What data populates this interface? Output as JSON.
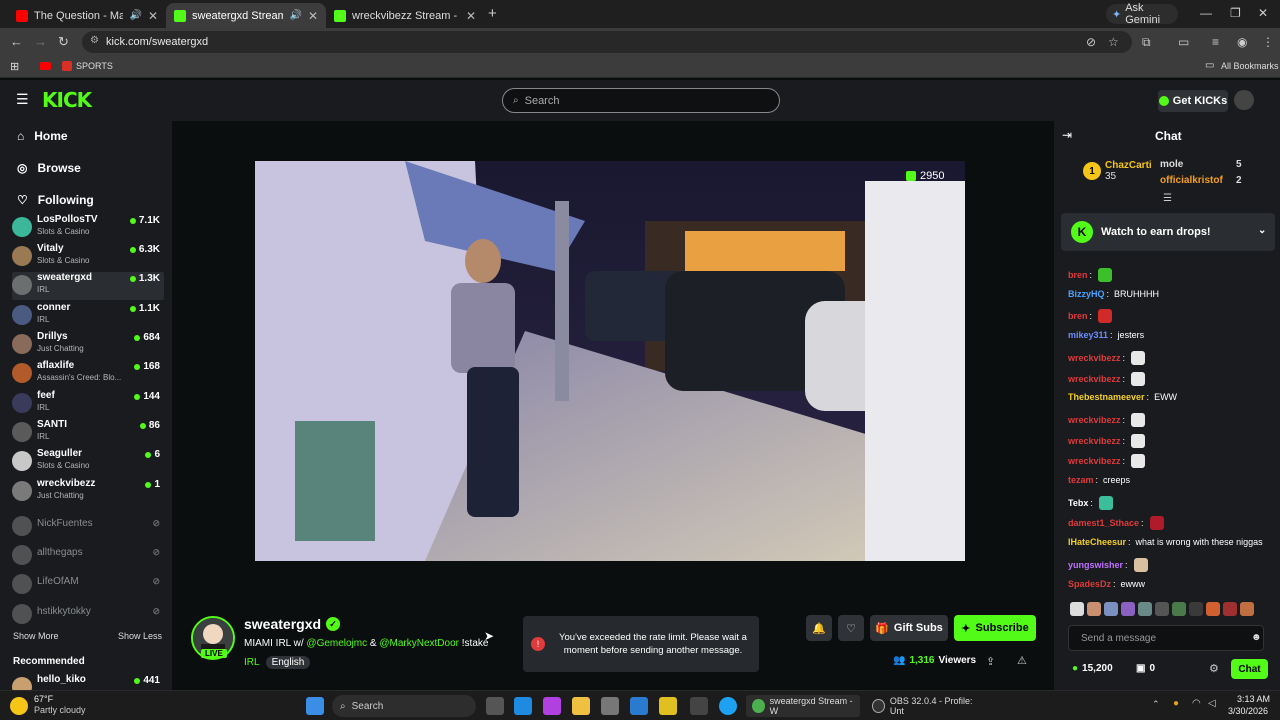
{
  "browser": {
    "tabs": [
      {
        "title": "The Question - Mac Miller",
        "icon": "youtube-icon",
        "color": "#ff0000"
      },
      {
        "title": "sweatergxd Stream - Watch",
        "icon": "kick-icon",
        "color": "#53fc18"
      },
      {
        "title": "wreckvibezz Stream - Watch Li",
        "icon": "kick-icon",
        "color": "#53fc18"
      }
    ],
    "ask_gemini": "Ask Gemini",
    "url": "kick.com/sweatergxd",
    "bookmarks": {
      "sports": "SPORTS",
      "all": "All Bookmarks"
    }
  },
  "kick": {
    "logo": "KICK",
    "search_placeholder": "Search",
    "get_kicks": "Get KICKs"
  },
  "sidebar": {
    "nav": [
      {
        "label": "Home",
        "icon": "home-icon"
      },
      {
        "label": "Browse",
        "icon": "compass-icon"
      },
      {
        "label": "Following",
        "icon": "heart-icon"
      }
    ],
    "channels": [
      {
        "name": "LosPollosTV",
        "category": "Slots & Casino",
        "viewers": "7.1K",
        "color": "#3bb89a"
      },
      {
        "name": "Vitaly",
        "category": "Slots & Casino",
        "viewers": "6.3K",
        "color": "#9a7a52"
      },
      {
        "name": "sweatergxd",
        "category": "IRL",
        "viewers": "1.3K",
        "color": "#6b6f70"
      },
      {
        "name": "conner",
        "category": "IRL",
        "viewers": "1.1K",
        "color": "#4a5a80"
      },
      {
        "name": "Drillys",
        "category": "Just Chatting",
        "viewers": "684",
        "color": "#8a6a5a"
      },
      {
        "name": "aflaxlife",
        "category": "Assassin's Creed: Blo...",
        "viewers": "168",
        "color": "#b35a2a"
      },
      {
        "name": "feef",
        "category": "IRL",
        "viewers": "144",
        "color": "#3a3a5a"
      },
      {
        "name": "SANTI",
        "category": "IRL",
        "viewers": "86",
        "color": "#5a5a5a"
      },
      {
        "name": "Seaguller",
        "category": "Slots & Casino",
        "viewers": "6",
        "color": "#c8c8c8"
      },
      {
        "name": "wreckvibezz",
        "category": "Just Chatting",
        "viewers": "1",
        "color": "#7a7a7a"
      }
    ],
    "offline": [
      "NickFuentes",
      "allthegaps",
      "LifeOfAM",
      "hstikkytokky"
    ],
    "show_more": "Show More",
    "show_less": "Show Less",
    "recommended": "Recommended",
    "recommended_channels": [
      {
        "name": "hello_kiko",
        "viewers": "441"
      }
    ]
  },
  "player": {
    "viewer_overlay": "2950"
  },
  "stream": {
    "streamer": "sweatergxd",
    "live": "LIVE",
    "title_prefix": "MIAMI IRL w/",
    "mention1": "@Gemelojmc",
    "amp": "&",
    "mention2": "@MarkyNextDoor",
    "title_suffix": "!stake",
    "tag_category": "IRL",
    "tag_language": "English",
    "gift_subs": "Gift Subs",
    "subscribe": "Subscribe",
    "viewers": "1,316",
    "viewers_label": "Viewers"
  },
  "toast": {
    "message": "You've exceeded the rate limit. Please wait a moment before sending another message."
  },
  "chat": {
    "title": "Chat",
    "leaderboard": [
      {
        "rank": "1",
        "name": "ChazCarti",
        "count": "35"
      },
      {
        "name": "mole",
        "count": "5"
      },
      {
        "name": "officialkristof",
        "count": "2"
      }
    ],
    "drops_banner": "Watch to earn drops!",
    "messages": [
      {
        "user": "bren",
        "text": "",
        "color": "#e03a3a",
        "emote": "#3bbf2a"
      },
      {
        "user": "BizzyHQ",
        "text": "BRUHHHH",
        "color": "#4aa3ff"
      },
      {
        "user": "bren",
        "text": "",
        "color": "#e03a3a",
        "emote": "#d02a2a"
      },
      {
        "user": "mikey311",
        "text": "jesters",
        "color": "#6a8cff"
      },
      {
        "user": "wreckvibezz",
        "text": "",
        "color": "#e03a3a",
        "emote": "#e8e8e8"
      },
      {
        "user": "wreckvibezz",
        "text": "",
        "color": "#e03a3a",
        "emote": "#e8e8e8"
      },
      {
        "user": "Thebestnameever",
        "text": "EWW",
        "color": "#f5d020"
      },
      {
        "user": "wreckvibezz",
        "text": "",
        "color": "#e03a3a",
        "emote": "#e8e8e8"
      },
      {
        "user": "wreckvibezz",
        "text": "",
        "color": "#e03a3a",
        "emote": "#e8e8e8"
      },
      {
        "user": "wreckvibezz",
        "text": "",
        "color": "#e03a3a",
        "emote": "#e8e8e8"
      },
      {
        "user": "tezam",
        "text": "creeps",
        "color": "#e03a3a"
      },
      {
        "user": "Tebx",
        "text": "",
        "color": "#ffffff",
        "emote": "#3bbf9a"
      },
      {
        "user": "damest1_Sthace",
        "text": "",
        "color": "#e03a3a",
        "emote": "#b01a2a"
      },
      {
        "user": "IHateCheesur",
        "text": "what is wrong with these niggas",
        "color": "#f5d020"
      },
      {
        "user": "yungswisher",
        "text": "",
        "color": "#c070ff",
        "emote": "#d8c0a0"
      },
      {
        "user": "SpadesDz",
        "text": "ewww",
        "color": "#e03a3a"
      }
    ],
    "input_placeholder": "Send a message",
    "kicks_balance": "15,200",
    "gift_count": "0",
    "send": "Chat"
  },
  "taskbar": {
    "weather_temp": "67°F",
    "weather_desc": "Partly cloudy",
    "search": "Search",
    "chrome_window": "sweatergxd Stream - W",
    "obs_window": "OBS 32.0.4 - Profile: Unt",
    "time": "3:13 AM",
    "date": "3/30/2026"
  }
}
